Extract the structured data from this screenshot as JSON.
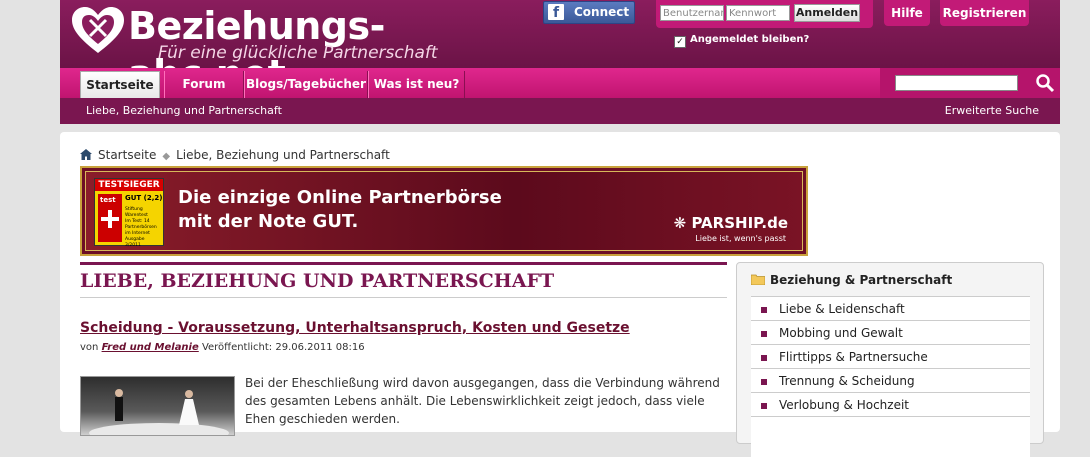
{
  "header": {
    "logo_title": "Beziehungs-abc.net",
    "logo_subtitle": "Für eine glückliche Partnerschaft",
    "facebook_label": "Connect",
    "login": {
      "username_placeholder": "Benutzername",
      "password_placeholder": "Kennwort",
      "submit_label": "Anmelden",
      "remember_label": "Angemeldet bleiben?",
      "remember_checked": true
    },
    "help_label": "Hilfe",
    "register_label": "Registrieren"
  },
  "nav": {
    "tabs": [
      {
        "label": "Startseite",
        "active": true
      },
      {
        "label": "Forum",
        "active": false
      },
      {
        "label": "Blogs/Tagebücher",
        "active": false
      },
      {
        "label": "Was ist neu?",
        "active": false
      }
    ],
    "search_placeholder": ""
  },
  "subnav": {
    "left": "Liebe, Beziehung und Partnerschaft",
    "right": "Erweiterte Suche"
  },
  "breadcrumb": {
    "home": "Startseite",
    "current": "Liebe, Beziehung und Partnerschaft"
  },
  "banner": {
    "badge_title": "TESTSIEGER",
    "badge_org": "Stiftung Warentest",
    "badge_grade": "GUT (2,2)",
    "badge_detail": "Im Test: 14 Partnerbörsen im Internet",
    "badge_issue": "Ausgabe 3/2011",
    "badge_logo": "test",
    "headline_line1": "Die einzige Online Partnerbörse",
    "headline_line2": "mit der Note GUT.",
    "brand": "PARSHIP.de",
    "brand_tagline": "Liebe ist, wenn's passt"
  },
  "section": {
    "title": "LIEBE, BEZIEHUNG UND PARTNERSCHAFT"
  },
  "article": {
    "title": "Scheidung - Voraussetzung, Unterhaltsanspruch, Kosten und Gesetze",
    "by_label": "von",
    "author": "Fred und Melanie",
    "published_label": "Veröffentlicht:",
    "published": "29.06.2011 08:16",
    "body": "Bei der Eheschließung wird davon ausgegangen, dass die Verbindung während des gesamten Lebens anhält. Die Lebenswirklichkeit zeigt jedoch, dass viele Ehen geschieden werden."
  },
  "sidebar": {
    "title": "Beziehung & Partnerschaft",
    "items": [
      "Liebe & Leidenschaft",
      "Mobbing und Gewalt",
      "Flirttipps & Partnersuche",
      "Trennung & Scheidung",
      "Verlobung & Hochzeit"
    ]
  },
  "colors": {
    "brand": "#7a1650",
    "accent": "#c21a77",
    "nav_pink": "#e0278d",
    "facebook": "#3b5998"
  }
}
